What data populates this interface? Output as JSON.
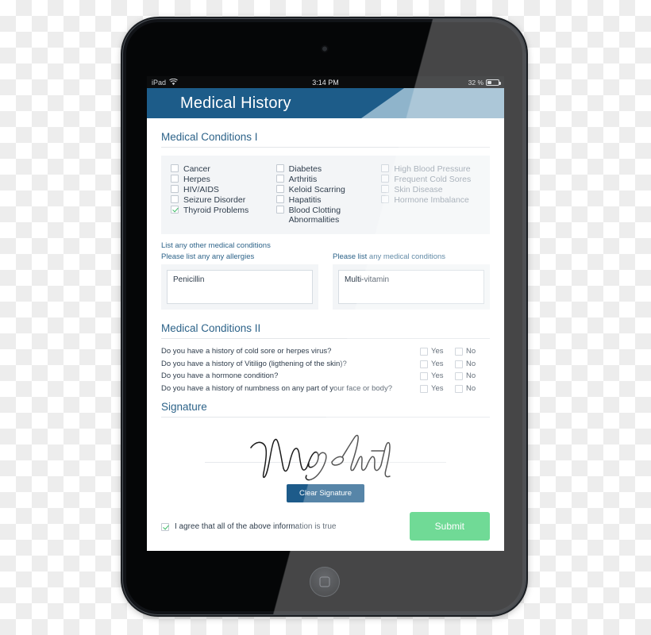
{
  "device": {
    "name": "tablet",
    "home_button_icon": "rounded-square-icon",
    "camera_icon": "front-camera-icon"
  },
  "statusbar": {
    "carrier": "iPad",
    "wifi_icon": "wifi-icon",
    "time": "3:14 PM",
    "battery_percent": "32 %",
    "battery_icon": "battery-icon"
  },
  "app": {
    "title": "Medical History",
    "header_dark_color": "#1d5c89",
    "header_light_color": "#8fb4cb"
  },
  "sections": {
    "conditions_1_title": "Medical Conditions I",
    "conditions_2_title": "Medical Conditions II",
    "signature_title": "Signature"
  },
  "conditions": {
    "column_1": [
      {
        "label": "Cancer",
        "checked": false
      },
      {
        "label": "Herpes",
        "checked": false
      },
      {
        "label": "HIV/AIDS",
        "checked": false
      },
      {
        "label": "Seizure Disorder",
        "checked": false
      },
      {
        "label": "Thyroid Problems",
        "checked": true
      }
    ],
    "column_2": [
      {
        "label": "Diabetes",
        "checked": false
      },
      {
        "label": "Arthritis",
        "checked": false
      },
      {
        "label": "Keloid Scarring",
        "checked": false
      },
      {
        "label": "Hapatitis",
        "checked": false
      },
      {
        "label": "Blood Clotting Abnormalities",
        "checked": false
      }
    ],
    "column_3": [
      {
        "label": "High Blood Pressure",
        "checked": false
      },
      {
        "label": "Frequent Cold Sores",
        "checked": false
      },
      {
        "label": "Skin Disease",
        "checked": false
      },
      {
        "label": "Hormone Imbalance",
        "checked": false
      }
    ]
  },
  "freetext": {
    "intro": "List any other medical conditions",
    "allergies_label": "Please list any any allergies",
    "allergies_value": "Penicillin",
    "conditions_label": "Please list any medical conditions",
    "conditions_value": "Multi-vitamin"
  },
  "questions": {
    "yes_label": "Yes",
    "no_label": "No",
    "items": [
      {
        "text": "Do you have a history of cold sore or herpes virus?",
        "yes": false,
        "no": false
      },
      {
        "text": "Do you have a history of Vitiligo (ligthening of the skin)?",
        "yes": false,
        "no": false
      },
      {
        "text": "Do you have a hormone condition?",
        "yes": false,
        "no": false
      },
      {
        "text": "Do you have a history of numbness on any part of your face or body?",
        "yes": false,
        "no": false
      }
    ]
  },
  "signature": {
    "signer_name": "Mary Smith",
    "clear_button": "Clear Signature",
    "clear_button_color": "#1d5b8a"
  },
  "footer": {
    "agree_label": "I agree that all of the above information is true",
    "agree_checked": true,
    "submit_label": "Submit",
    "submit_color": "#3ecd72",
    "check_color": "#3fbd68"
  }
}
